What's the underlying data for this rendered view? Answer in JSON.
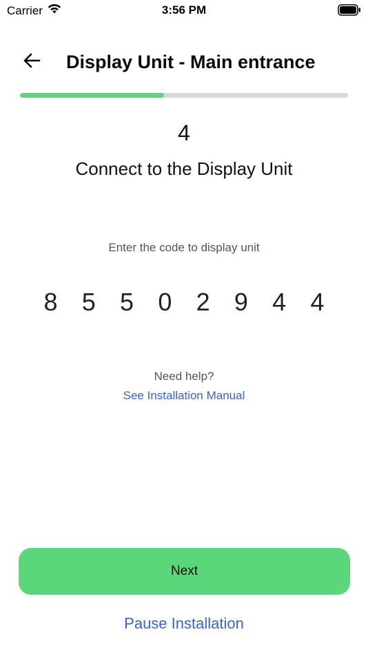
{
  "status_bar": {
    "carrier": "Carrier",
    "time": "3:56 PM"
  },
  "header": {
    "title": "Display Unit - Main entrance"
  },
  "progress": {
    "fraction": 0.44
  },
  "step": {
    "number": "4",
    "title": "Connect to the Display Unit"
  },
  "code": {
    "label": "Enter the code to display unit",
    "digits": [
      "8",
      "5",
      "5",
      "0",
      "2",
      "9",
      "4",
      "4"
    ]
  },
  "help": {
    "text": "Need help?",
    "link": "See Installation Manual"
  },
  "actions": {
    "next_label": "Next",
    "pause_label": "Pause Installation"
  },
  "colors": {
    "accent_green": "#5bd77b",
    "link_blue": "#3563d8",
    "track_gray": "#d8d8d8"
  },
  "icons": {
    "back": "arrow-left-icon",
    "wifi": "wifi-icon",
    "battery": "battery-icon"
  }
}
